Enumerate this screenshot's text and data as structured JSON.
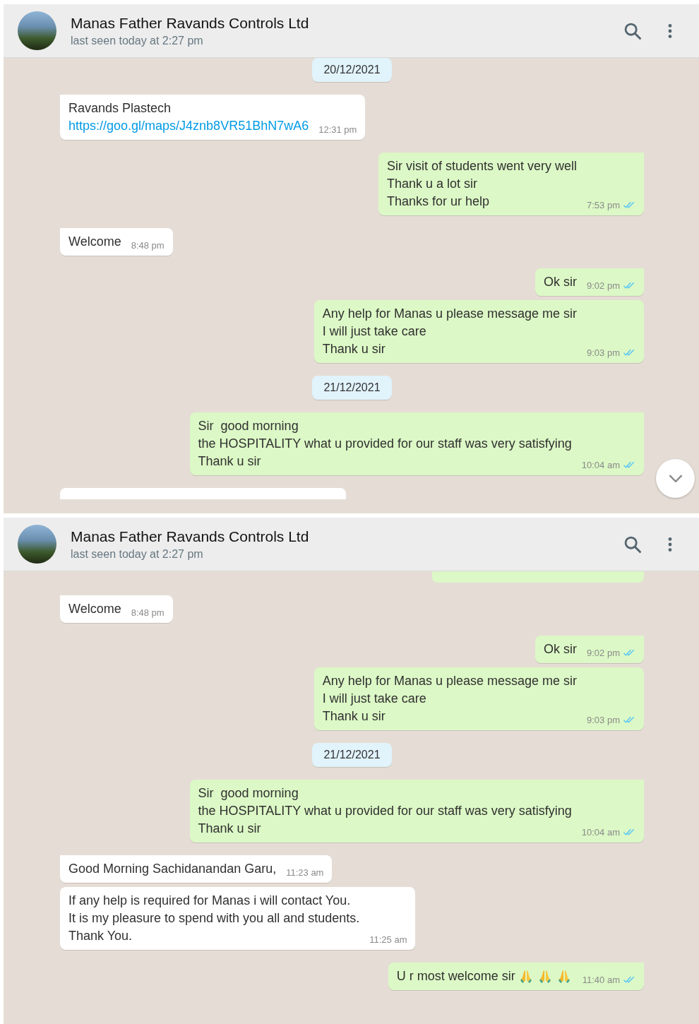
{
  "panels": [
    {
      "contact": {
        "name": "Manas Father Ravands Controls Ltd",
        "status": "last seen today at 2:27 pm"
      },
      "scroll_down_button": true,
      "items": [
        {
          "kind": "date",
          "text": "20/12/2021"
        },
        {
          "kind": "incoming",
          "tail": true,
          "lines": [
            "Ravands Plastech"
          ],
          "link": "https://goo.gl/maps/J4znb8VR51BhN7wA6",
          "time": "12:31 pm"
        },
        {
          "kind": "outgoing",
          "tail": true,
          "lines": [
            "Sir visit of students went very well",
            "Thank u a lot sir",
            "Thanks for ur help"
          ],
          "time": "7:53 pm",
          "read": true
        },
        {
          "kind": "incoming",
          "tail": true,
          "lines": [
            "Welcome"
          ],
          "time": "8:48 pm"
        },
        {
          "kind": "outgoing",
          "tail": true,
          "lines": [
            "Ok sir"
          ],
          "time": "9:02 pm",
          "read": true
        },
        {
          "kind": "outgoing",
          "tail": false,
          "lines": [
            "Any help for Manas u please message me sir",
            "I will just take care",
            "Thank u sir"
          ],
          "time": "9:03 pm",
          "read": true
        },
        {
          "kind": "date",
          "text": "21/12/2021"
        },
        {
          "kind": "outgoing",
          "tail": true,
          "lines": [
            "Sir  good morning",
            "the HOSPITALITY what u provided for our staff was very satisfying",
            "Thank u sir"
          ],
          "time": "10:04 am",
          "read": true
        },
        {
          "kind": "clipped_incoming"
        }
      ]
    },
    {
      "contact": {
        "name": "Manas Father Ravands Controls Ltd",
        "status": "last seen today at 2:27 pm"
      },
      "items": [
        {
          "kind": "clipped_outgoing"
        },
        {
          "kind": "incoming",
          "tail": true,
          "lines": [
            "Welcome"
          ],
          "time": "8:48 pm"
        },
        {
          "kind": "outgoing",
          "tail": true,
          "lines": [
            "Ok sir"
          ],
          "time": "9:02 pm",
          "read": true
        },
        {
          "kind": "outgoing",
          "tail": false,
          "lines": [
            "Any help for Manas u please message me sir",
            "I will just take care",
            "Thank u sir"
          ],
          "time": "9:03 pm",
          "read": true
        },
        {
          "kind": "date",
          "text": "21/12/2021"
        },
        {
          "kind": "outgoing",
          "tail": true,
          "lines": [
            "Sir  good morning",
            "the HOSPITALITY what u provided for our staff was very satisfying",
            "Thank u sir"
          ],
          "time": "10:04 am",
          "read": true
        },
        {
          "kind": "incoming",
          "tail": true,
          "lines": [
            "Good Morning Sachidanandan Garu,"
          ],
          "time": "11:23 am"
        },
        {
          "kind": "incoming",
          "tail": false,
          "lines": [
            "If any help is required for Manas i will contact You.",
            "It is my pleasure to spend with you all and students.",
            "Thank You."
          ],
          "time": "11:25 am"
        },
        {
          "kind": "outgoing",
          "tail": true,
          "lines": [
            "U r most welcome sir"
          ],
          "icons": [
            {
              "kind": "praying-hands"
            },
            {
              "kind": "praying-hands"
            },
            {
              "kind": "praying-hands"
            }
          ],
          "time": "11:40 am",
          "read": true
        }
      ]
    }
  ]
}
